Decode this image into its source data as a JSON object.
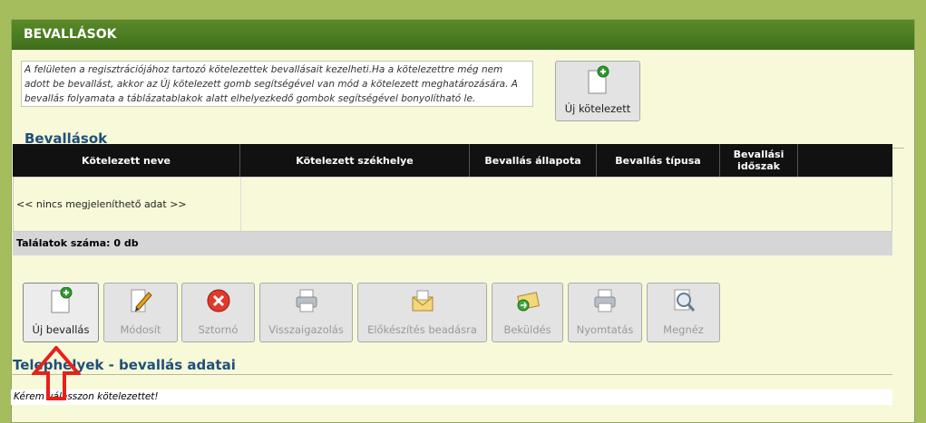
{
  "panel": {
    "title": "BEVALLÁSOK",
    "info_text": "A felületen a regisztrációjához tartozó kötelezettek bevallásait kezelheti.Ha a kötelezettre még nem adott be bevallást, akkor az Új kötelezett gomb segítségével van mód a kötelezett meghatározására. A bevallás folyamata a táblázatablakok alatt elhelyezkedő gombok segítségével bonyolítható le.",
    "new_obligor_button": "Új kötelezett"
  },
  "returns": {
    "title": "Bevallások",
    "columns": [
      "Kötelezett neve",
      "Kötelezett székhelye",
      "Bevallás állapota",
      "Bevallás típusa",
      "Bevallási időszak",
      ""
    ],
    "empty_text": "<< nincs megjeleníthető adat >>",
    "count_text": "Találatok száma: 0 db"
  },
  "toolbar": {
    "new_return": "Új bevallás",
    "modify": "Módosít",
    "cancel": "Sztornó",
    "confirmation": "Visszaigazolás",
    "prepare": "Előkészítés beadásra",
    "send": "Beküldés",
    "print": "Nyomtatás",
    "view": "Megnéz"
  },
  "sites": {
    "title": "Telephelyek - bevallás adatai",
    "message": "Kérem válasszon kötelezettet!"
  },
  "colors": {
    "header_green": "#4a7a22",
    "panel_bg": "#f7f9d9",
    "outer_bg": "#a6bd5e",
    "arrow_red": "#e8201c"
  }
}
